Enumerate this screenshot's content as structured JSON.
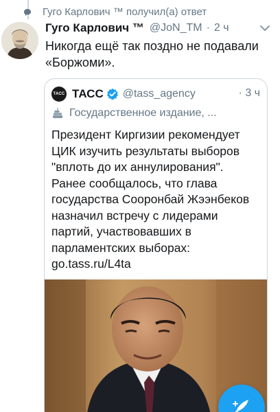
{
  "social_context": {
    "text": "Гуго Карлович ™ получил(а) ответ",
    "icon": "speech-bubble-icon"
  },
  "tweet": {
    "author_name": "Гуго Карлович ™",
    "handle": "@JoN_TM",
    "separator": "·",
    "time": "2 ч",
    "text": "Никогда ещё так поздно не подавали «Боржоми».",
    "avatar_icon": "portrait-avatar"
  },
  "quoted": {
    "logo_text": "ТАСС",
    "name": "ТАСС",
    "verified_icon": "verified-badge-icon",
    "handle": "@tass_agency",
    "separator": "·",
    "time": "3 ч",
    "label_icon": "government-building-icon",
    "label": "Государственное издание, ...",
    "text": "Президент Киргизии рекомендует\nЦИК изучить результаты выборов\n\"вплоть до их аннулирования\".\nРанее сообщалось, что глава\nгосударства Сооронбай Жээнбеков\nназначил встречу с лидерами\nпартий, участвовавших в\nпарламентских выборах:\ngo.tass.ru/L4ta",
    "image_icon": "man-portrait-photo"
  },
  "fab": {
    "icon": "compose-tweet-icon"
  },
  "colors": {
    "accent": "#1da1f2",
    "secondary_text": "#657786",
    "border": "#ccd6dd"
  }
}
